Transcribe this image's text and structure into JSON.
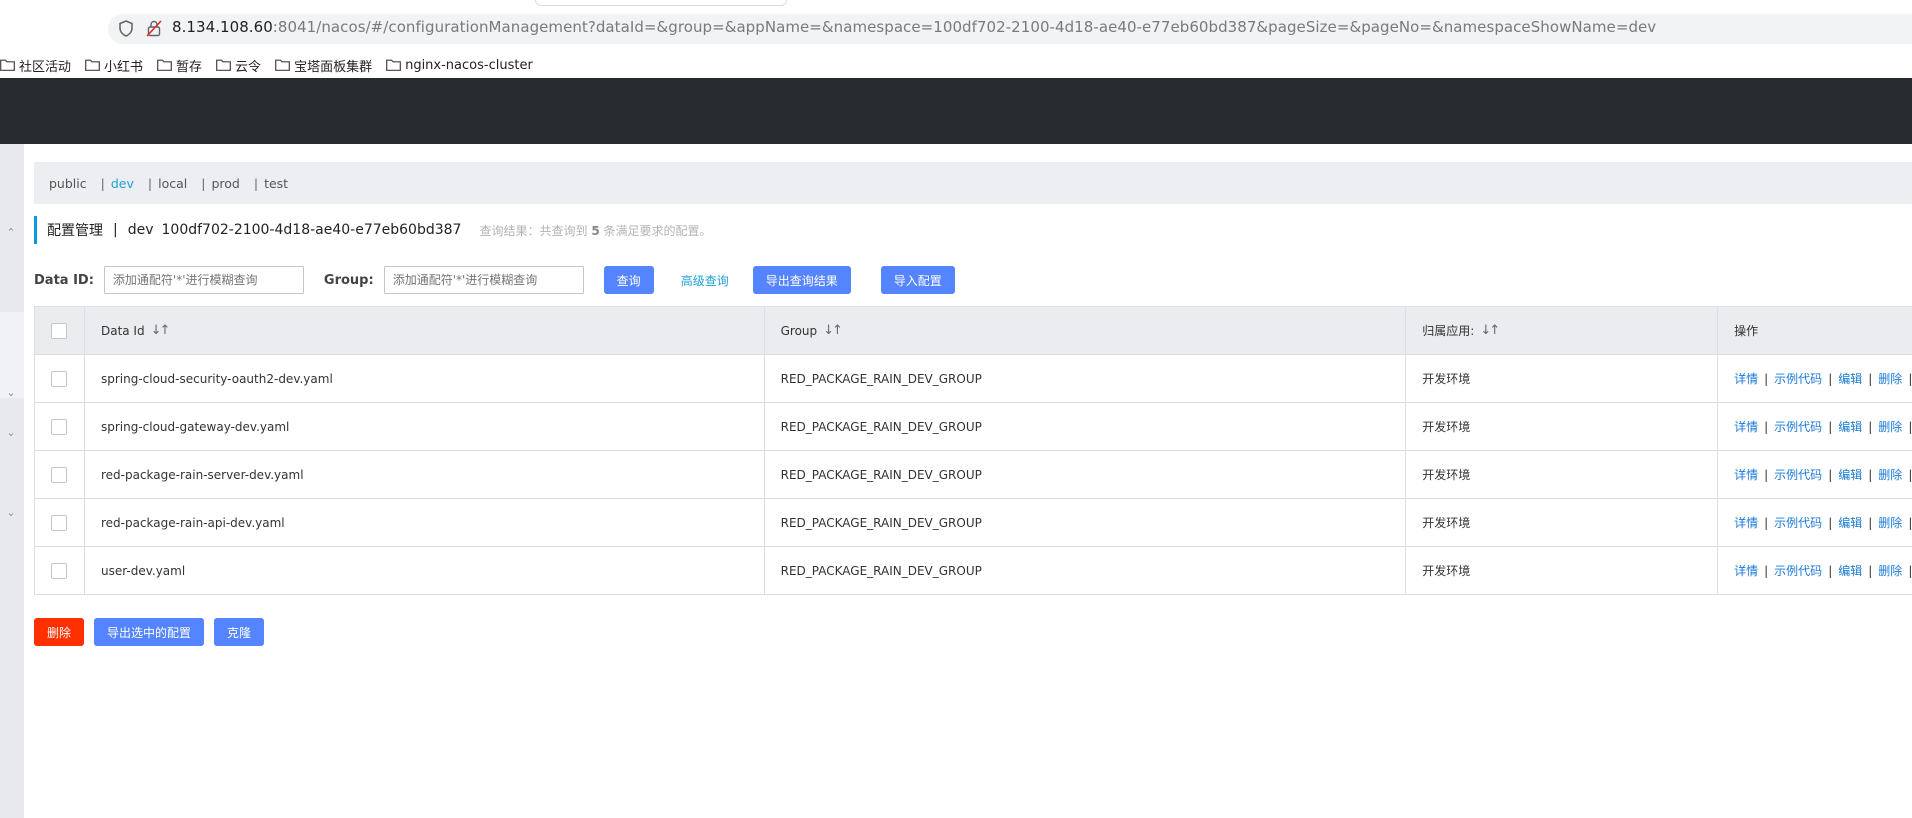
{
  "browser": {
    "url_host": "8.134.108.60",
    "url_rest": ":8041/nacos/#/configurationManagement?dataId=&group=&appName=&namespace=100df702-2100-4d18-ae40-e77eb60bd387&pageSize=&pageNo=&namespaceShowName=dev",
    "bookmarks": [
      "社区活动",
      "小红书",
      "暂存",
      "云令",
      "宝塔面板集群",
      "nginx-nacos-cluster"
    ]
  },
  "namespaces": {
    "items": [
      "public",
      "dev",
      "local",
      "prod",
      "test"
    ],
    "active": "dev",
    "separator": "|"
  },
  "title": {
    "page": "配置管理",
    "separator": "|",
    "namespace_name": "dev",
    "namespace_id": "100df702-2100-4d18-ae40-e77eb60bd387",
    "summary_prefix": "查询结果：共查询到",
    "summary_count": "5",
    "summary_suffix": "条满足要求的配置。"
  },
  "search": {
    "dataid_label": "Data ID:",
    "dataid_placeholder": "添加通配符'*'进行模糊查询",
    "group_label": "Group:",
    "group_placeholder": "添加通配符'*'进行模糊查询",
    "query_button": "查询",
    "advanced_query": "高级查询",
    "export_results_button": "导出查询结果",
    "import_button": "导入配置"
  },
  "table": {
    "columns": [
      "Data Id",
      "Group",
      "归属应用:",
      "操作"
    ],
    "rows": [
      {
        "data_id": "spring-cloud-security-oauth2-dev.yaml",
        "group": "RED_PACKAGE_RAIN_DEV_GROUP",
        "app": "开发环境"
      },
      {
        "data_id": "spring-cloud-gateway-dev.yaml",
        "group": "RED_PACKAGE_RAIN_DEV_GROUP",
        "app": "开发环境"
      },
      {
        "data_id": "red-package-rain-server-dev.yaml",
        "group": "RED_PACKAGE_RAIN_DEV_GROUP",
        "app": "开发环境"
      },
      {
        "data_id": "red-package-rain-api-dev.yaml",
        "group": "RED_PACKAGE_RAIN_DEV_GROUP",
        "app": "开发环境"
      },
      {
        "data_id": "user-dev.yaml",
        "group": "RED_PACKAGE_RAIN_DEV_GROUP",
        "app": "开发环境"
      }
    ],
    "operations": [
      "详情",
      "示例代码",
      "编辑",
      "删除"
    ]
  },
  "bottom_actions": {
    "delete": "删除",
    "export_selected": "导出选中的配置",
    "clone": "克隆"
  },
  "colors": {
    "header_bg": "#262b30",
    "primary": "#5584ff",
    "danger": "#ff3000",
    "link": "#1a7bd6",
    "active_namespace": "#20a0d8"
  }
}
